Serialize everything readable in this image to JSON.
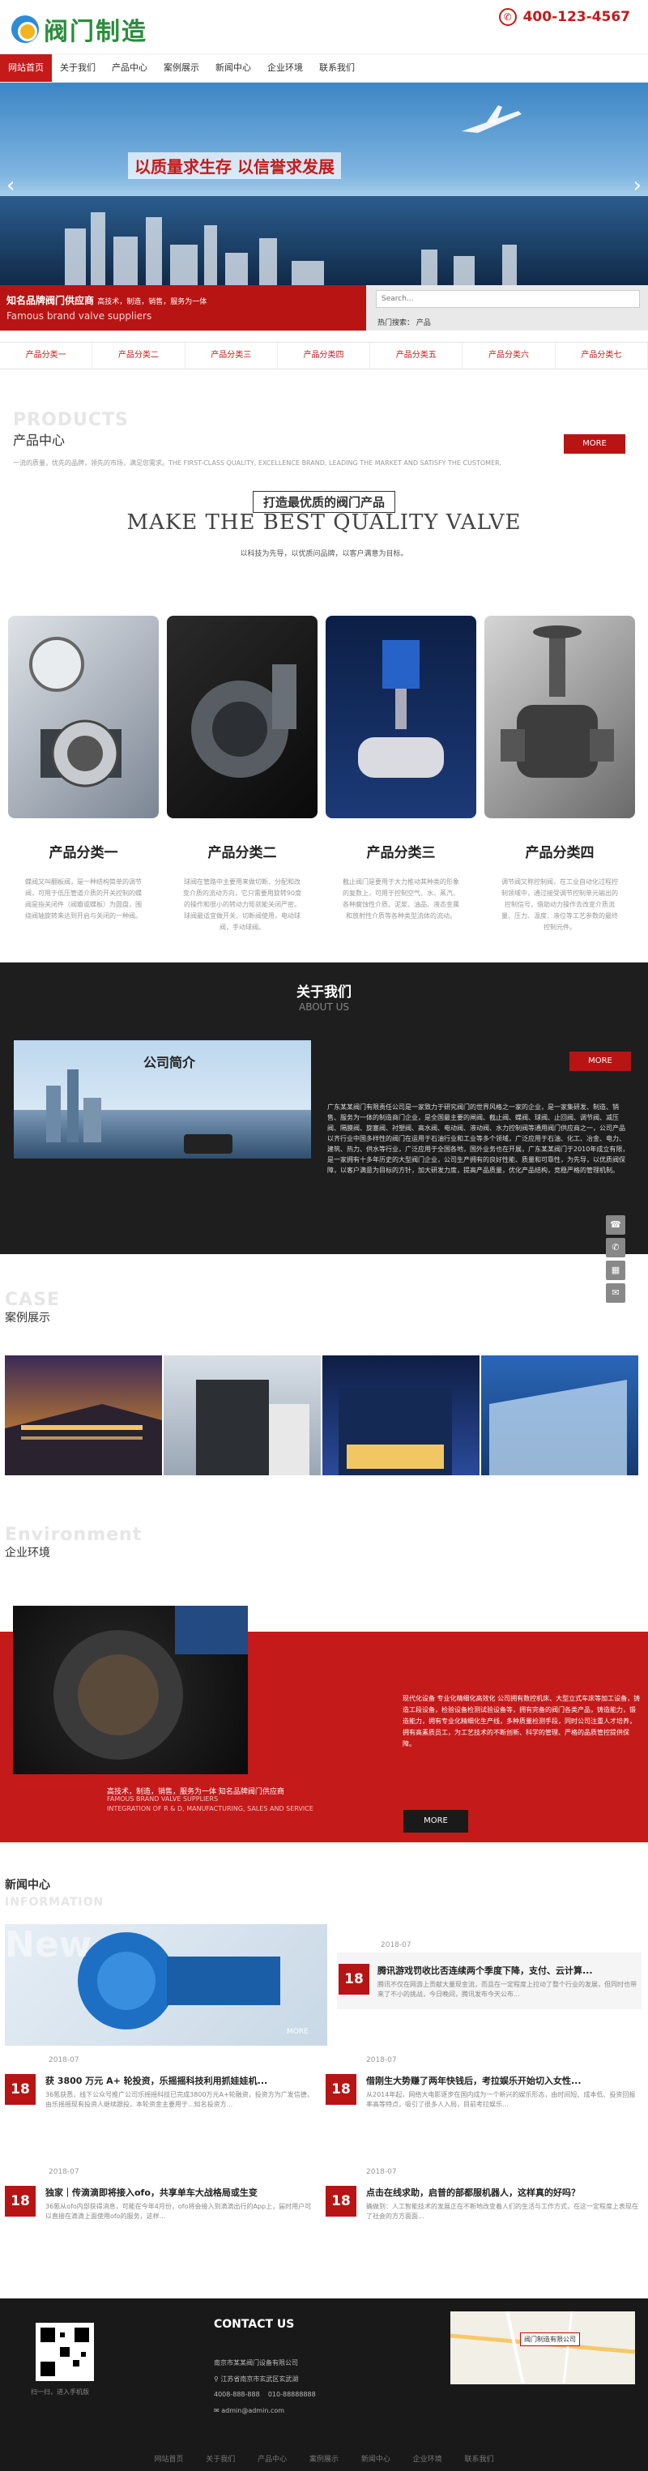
{
  "header": {
    "logo_text": "阀门制造",
    "phone": "400-123-4567"
  },
  "nav": [
    "网站首页",
    "关于我们",
    "产品中心",
    "案例展示",
    "新闻中心",
    "企业环境",
    "联系我们"
  ],
  "banner": {
    "slogan": "以质量求生存 以信誉求发展"
  },
  "brand": {
    "title": "知名品牌阀门供应商",
    "title_small": "高技术，制造，销售，服务为一体",
    "subtitle": "Famous brand valve suppliers"
  },
  "search": {
    "placeholder": "Search...",
    "hot_label": "热门搜索：",
    "hot_word": "产品"
  },
  "categories": [
    "产品分类一",
    "产品分类二",
    "产品分类三",
    "产品分类四",
    "产品分类五",
    "产品分类六",
    "产品分类七"
  ],
  "products": {
    "en": "PRODUCTS",
    "cn": "产品中心",
    "sub": "一流的质量，优先的品牌，领先的市场，满足您需求。THE FIRST-CLASS QUALITY, EXCELLENCE BRAND, LEADING THE MARKET AND SATISFY THE CUSTOMER.",
    "more": "MORE",
    "headline_cn": "打造最优质的阀门产品",
    "headline_en": "MAKE THE BEST QUALITY VALVE",
    "tagline": "以科技为先导，以优质问品牌，以客户满意为目标。",
    "items": [
      {
        "name": "产品分类一",
        "desc": "蝶阀又叫翻板阀，是一种结构简单的调节阀，可用于低压管道介质的开关控制的蝶阀是指关闭件（阀瓣或蝶板）为圆盘，围绕阀轴旋转来达到开启与关闭的一种阀。"
      },
      {
        "name": "产品分类二",
        "desc": "球阀在管路中主要用来做切断、分配和改变介质的流动方向，它只需要用旋转90度的操作和很小的转动力矩就能关闭严密。球阀最适宜做开关、切断阀使用，电动球阀，手动球阀。"
      },
      {
        "name": "产品分类三",
        "desc": "截止阀门是要用于大力推动其种类的形象的复数上，可用于控制空气、水、蒸汽、各种腐蚀性介质、泥浆、油品、液态金属和放射性介质等各种类型流体的流动。"
      },
      {
        "name": "产品分类四",
        "desc": "调节阀又称控制阀，在工业自动化过程控制领域中，通过接受调节控制单元输出的控制信号，借助动力操作去改变介质流量、压力、温度、液位等工艺参数的最终控制元件。"
      }
    ]
  },
  "about": {
    "title": "关于我们",
    "en": "ABOUT US",
    "more": "MORE",
    "img_caption": "公司简介",
    "text": "广东某某阀门有限责任公司是一家致力于研究阀门的世界风格之一家的企业，是一家集研发、制造、销售、服务为一体的制造商门企业，是全国最主要的闸阀、截止阀、蝶阀、球阀、止回阀、调节阀、减压阀、隔膜阀、旋塞阀、衬塑阀、高水阀、电动阀、液动阀、水力控制阀等通用阀门供应商之一，公司产品以齐行业中国多样性的阀门在运用于石油行业和工业等多个领域，广泛应用于石油、化工、冶金、电力、建筑、热力、供水等行业，广泛应用于全国各地，国外业务也在开展，广东某某阀门于2010年成立有限，是一家拥有十多年历史的大型阀门企业，公司生产拥有的良好性能、质量和可靠性，为先导，以优质阀保障，以客户满意为目标的方针，加大研发力度，提高产品质量，优化产品结构，竞稳严格的管理机制。"
  },
  "sidebar_tools": [
    "☎",
    "✆",
    "▦",
    "✉"
  ],
  "cases": {
    "en": "CASE",
    "cn": "案例展示"
  },
  "environment": {
    "en": "Environment",
    "cn": "企业环境",
    "text": "现代化设备 专业化精细化高效化 公司拥有数控机床、大型立式车床等加工设备，铸造工段设备，检验设备检测试验设备等，拥有完备的阀门各类产品，铸造能力，锻造能力，拥有专业化精细化生产线，多种质量检测手段，同时公司注重人才培养，拥有高素质员工，为工艺技术的不断创新、科学的管理、严格的品质管控提供保障。",
    "line1": "高技术，制造，销售，服务为一体 知名品牌阀门供应商",
    "line2": "FAMOUS BRAND VALVE SUPPLIERS",
    "line3": "INTEGRATION OF R & D, MANUFACTURING, SALES AND SERVICE",
    "more": "MORE"
  },
  "news": {
    "cn": "新闻中心",
    "en": "INFORMATION",
    "watermark": "New",
    "img_more": "MORE",
    "items": [
      {
        "date": "2018-07",
        "day": "18",
        "title": "腾讯游戏罚收比否连续两个季度下降，支付、云计算...",
        "desc": "腾讯不仅在网游上贡献大量现金流，而且在一定程度上拉动了整个行业的发展，但同时也带来了不小的挑战，今日晚间，腾讯发布今天公布..."
      },
      {
        "date": "2018-07",
        "day": "18",
        "title": "获 3800 万元 A+ 轮投资，乐摇摇科技利用抓娃娃机...",
        "desc": "36氪获悉，线下公众号推广公司乐摇摇科技已完成3800万元A+轮融资，投资方为广发信德，由乐摇摇现有投资人继续跟投，本轮资金主要用于...知名投资方..."
      },
      {
        "date": "2018-07",
        "day": "18",
        "title": "借刚生大势赚了两年快钱后，考拉娱乐开始切入女性...",
        "desc": "从2014年起，网络大电影逐步在国内成为一个新兴的娱乐形态，由时间短、成本低、投资回报率高等特点，吸引了很多人入局，目前考拉娱乐..."
      },
      {
        "date": "2018-07",
        "day": "18",
        "title": "独家｜传滴滴即将接入ofo，共享单车大战格局或生变",
        "desc": "36氪从ofo内部获得消息，可能在今年4月份，ofo将会接入到滴滴出行的App上，届时用户可以直接在滴滴上面使用ofo的服务，这样..."
      },
      {
        "date": "2018-07",
        "day": "18",
        "title": "点击在线求助，启普的部都服机器人，这样真的好吗？",
        "desc": "确做到：人工智能技术的发展正在不断地改变着人们的生活与工作方式，在这一定程度上表现在了社会的方方面面..."
      }
    ]
  },
  "footer": {
    "qr_caption": "扫一扫，进入手机版",
    "contact_title": "CONTACT US",
    "company": "南京市某某阀门设备有限公司",
    "address": "江苏省南京市玄武区玄武湖",
    "phones": "4008-888-888    010-88888888",
    "email": "admin@admin.com",
    "map_label": "阀门制造有限公司",
    "nav": [
      "网站首页",
      "关于我们",
      "产品中心",
      "案例展示",
      "新闻中心",
      "企业环境",
      "联系我们"
    ]
  }
}
